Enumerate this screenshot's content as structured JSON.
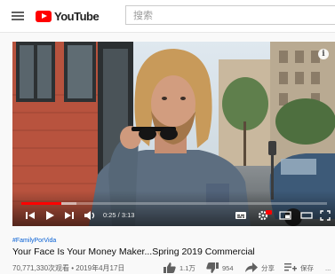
{
  "header": {
    "logo_text": "YouTube",
    "search_placeholder": "搜索"
  },
  "player": {
    "current_time": "0:25",
    "duration": "3:13",
    "time_display": "0:25 / 3:13",
    "played_fraction": 0.13,
    "buffered_fraction": 0.18,
    "progress_color": "#ff0000"
  },
  "video": {
    "hashtag": "#FamilyPorVida",
    "title": "Your Face Is Your Money Maker...Spring 2019 Commercial",
    "views_date": "70,771,330次观看 • 2019年4月17日",
    "likes": "1.1万",
    "dislikes": "954",
    "share_label": "分享",
    "save_label": "保存",
    "more_label": "..."
  },
  "colors": {
    "brand_red": "#ff0000",
    "link_blue": "#065fd4",
    "meta_gray": "#606060"
  },
  "icons": [
    "menu-icon",
    "youtube-logo-icon",
    "info-icon",
    "skip-previous-icon",
    "play-icon",
    "skip-next-icon",
    "volume-icon",
    "subtitles-icon",
    "settings-icon",
    "miniplayer-icon",
    "theater-icon",
    "fullscreen-icon",
    "thumbs-up-icon",
    "thumbs-down-icon",
    "share-icon",
    "playlist-add-icon",
    "more-icon"
  ]
}
